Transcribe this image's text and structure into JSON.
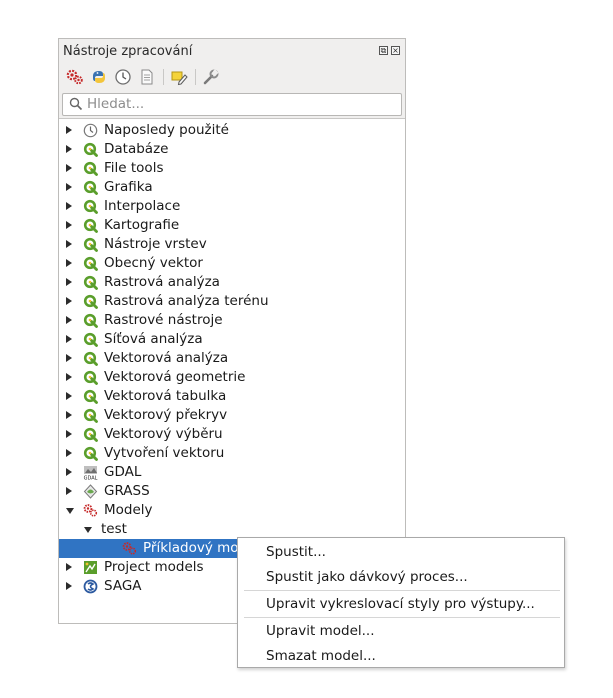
{
  "panel": {
    "title": "Nástroje zpracování",
    "float_button": "⧉",
    "close_button": "×"
  },
  "search": {
    "placeholder": "Hledat..."
  },
  "tree": {
    "items": [
      {
        "label": "Naposledy použité",
        "icon": "clock-icon"
      },
      {
        "label": "Databáze",
        "icon": "qgis-icon"
      },
      {
        "label": "File tools",
        "icon": "qgis-icon"
      },
      {
        "label": "Grafika",
        "icon": "qgis-icon"
      },
      {
        "label": "Interpolace",
        "icon": "qgis-icon"
      },
      {
        "label": "Kartografie",
        "icon": "qgis-icon"
      },
      {
        "label": "Nástroje vrstev",
        "icon": "qgis-icon"
      },
      {
        "label": "Obecný vektor",
        "icon": "qgis-icon"
      },
      {
        "label": "Rastrová analýza",
        "icon": "qgis-icon"
      },
      {
        "label": "Rastrová analýza terénu",
        "icon": "qgis-icon"
      },
      {
        "label": "Rastrové nástroje",
        "icon": "qgis-icon"
      },
      {
        "label": "Síťová analýza",
        "icon": "qgis-icon"
      },
      {
        "label": "Vektorová analýza",
        "icon": "qgis-icon"
      },
      {
        "label": "Vektorová geometrie",
        "icon": "qgis-icon"
      },
      {
        "label": "Vektorová tabulka",
        "icon": "qgis-icon"
      },
      {
        "label": "Vektorový překryv",
        "icon": "qgis-icon"
      },
      {
        "label": "Vektorový výběru",
        "icon": "qgis-icon"
      },
      {
        "label": "Vytvoření vektoru",
        "icon": "qgis-icon"
      },
      {
        "label": "GDAL",
        "icon": "gdal-icon"
      },
      {
        "label": "GRASS",
        "icon": "grass-icon"
      },
      {
        "label": "Modely",
        "icon": "model-icon"
      },
      {
        "label": "test",
        "icon": ""
      },
      {
        "label": "Příkladový model",
        "icon": "model-icon"
      },
      {
        "label": "Project models",
        "icon": "project-models-icon"
      },
      {
        "label": "SAGA",
        "icon": "saga-icon"
      }
    ]
  },
  "context_menu": {
    "run": "Spustit...",
    "run_batch": "Spustit jako dávkový proces...",
    "edit_styles": "Upravit vykreslovací styly pro výstupy...",
    "edit_model": "Upravit model...",
    "delete_model": "Smazat model..."
  },
  "colors": {
    "selection": "#3074c3",
    "qgis_green": "#5a9e2b",
    "model_red": "#c62a2a"
  }
}
